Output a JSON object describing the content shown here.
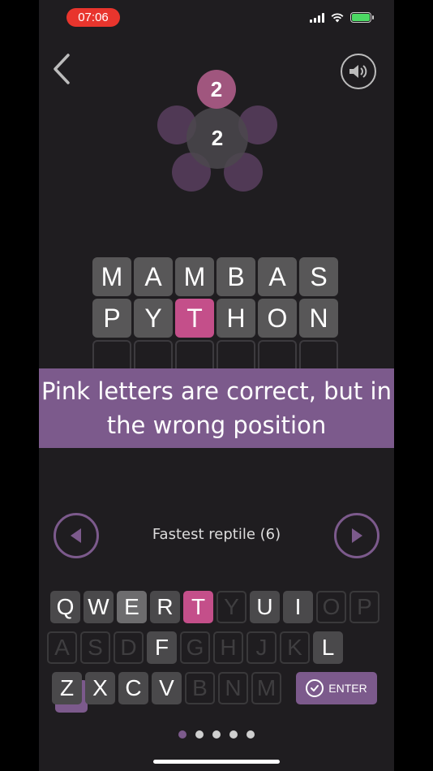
{
  "status_bar": {
    "time": "07:06"
  },
  "score": {
    "top": "2",
    "center": "2"
  },
  "board": {
    "rows": [
      [
        {
          "letter": "M",
          "state": "gray"
        },
        {
          "letter": "A",
          "state": "gray"
        },
        {
          "letter": "M",
          "state": "gray"
        },
        {
          "letter": "B",
          "state": "gray"
        },
        {
          "letter": "A",
          "state": "gray"
        },
        {
          "letter": "S",
          "state": "gray"
        }
      ],
      [
        {
          "letter": "P",
          "state": "gray"
        },
        {
          "letter": "Y",
          "state": "gray"
        },
        {
          "letter": "T",
          "state": "pink"
        },
        {
          "letter": "H",
          "state": "gray"
        },
        {
          "letter": "O",
          "state": "gray"
        },
        {
          "letter": "N",
          "state": "gray"
        }
      ],
      [
        {
          "letter": "",
          "state": "empty"
        },
        {
          "letter": "",
          "state": "empty"
        },
        {
          "letter": "",
          "state": "empty"
        },
        {
          "letter": "",
          "state": "empty"
        },
        {
          "letter": "",
          "state": "empty"
        },
        {
          "letter": "",
          "state": "empty"
        }
      ]
    ]
  },
  "banner": {
    "line1": "Pink letters are correct, but in",
    "line2": "the wrong position"
  },
  "clue": {
    "text": "Fastest reptile (6)"
  },
  "keyboard": {
    "row1": [
      {
        "k": "Q",
        "s": "normal"
      },
      {
        "k": "W",
        "s": "normal"
      },
      {
        "k": "E",
        "s": "light"
      },
      {
        "k": "R",
        "s": "normal"
      },
      {
        "k": "T",
        "s": "pink"
      },
      {
        "k": "Y",
        "s": "dead"
      },
      {
        "k": "U",
        "s": "normal"
      },
      {
        "k": "I",
        "s": "normal"
      },
      {
        "k": "O",
        "s": "dead"
      },
      {
        "k": "P",
        "s": "dead"
      }
    ],
    "row2": [
      {
        "k": "A",
        "s": "dead"
      },
      {
        "k": "S",
        "s": "dead"
      },
      {
        "k": "D",
        "s": "dead"
      },
      {
        "k": "F",
        "s": "normal"
      },
      {
        "k": "G",
        "s": "dead"
      },
      {
        "k": "H",
        "s": "dead"
      },
      {
        "k": "J",
        "s": "dead"
      },
      {
        "k": "K",
        "s": "dead"
      },
      {
        "k": "L",
        "s": "normal"
      }
    ],
    "row3": [
      {
        "k": "Z",
        "s": "normal"
      },
      {
        "k": "X",
        "s": "normal"
      },
      {
        "k": "C",
        "s": "normal"
      },
      {
        "k": "V",
        "s": "normal"
      },
      {
        "k": "B",
        "s": "dead"
      },
      {
        "k": "N",
        "s": "dead"
      },
      {
        "k": "M",
        "s": "dead"
      }
    ],
    "enter_label": "ENTER"
  },
  "pager": {
    "count": 5,
    "active_index": 0
  },
  "colors": {
    "accent": "#7c5a8c",
    "pink": "#c44f8a",
    "tile": "#585758",
    "background": "#1f1d20"
  },
  "icons": [
    "back-chevron-icon",
    "speaker-icon",
    "prev-arrow-icon",
    "next-arrow-icon",
    "backspace-icon",
    "check-icon"
  ]
}
